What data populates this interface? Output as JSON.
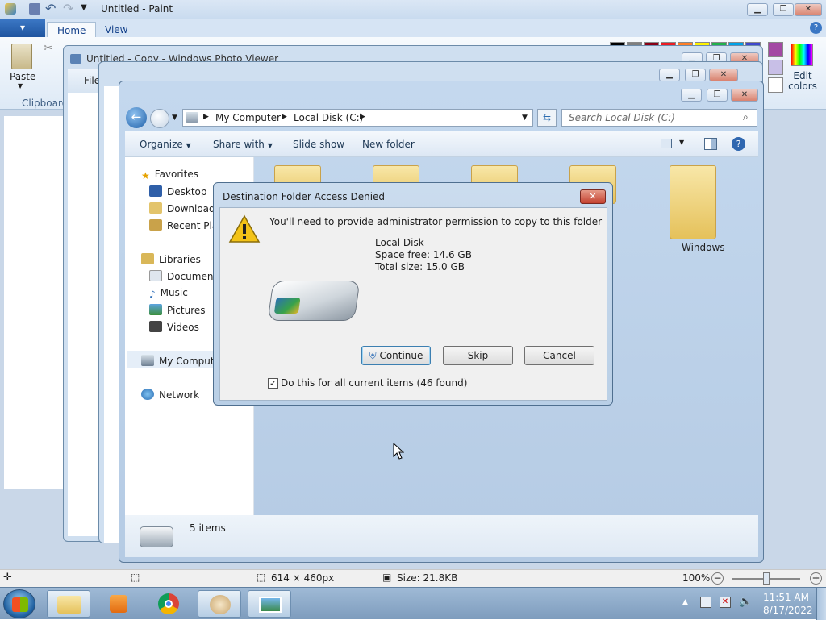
{
  "paint": {
    "title": "Untitled - Paint",
    "menu_label": "▾",
    "tabs": [
      "Home",
      "View"
    ],
    "paste_label": "Paste",
    "clipboard_label": "Clipboard",
    "edit_colors_label": "Edit colors",
    "status": {
      "dimensions": "614 × 460px",
      "size": "Size: 21.8KB",
      "zoom": "100%"
    }
  },
  "photo_viewer": {
    "title": "Untitled - Copy - Windows Photo Viewer",
    "file_label": "File"
  },
  "explorer": {
    "breadcrumb": [
      "My Computer",
      "Local Disk (C:)"
    ],
    "search_placeholder": "Search Local Disk (C:)",
    "commands": [
      "Organize",
      "Share with",
      "Slide show",
      "New folder"
    ],
    "nav": {
      "favorites": "Favorites",
      "desktop": "Desktop",
      "downloads": "Downloads",
      "recent": "Recent Places",
      "libraries": "Libraries",
      "documents": "Documents",
      "music": "Music",
      "pictures": "Pictures",
      "videos": "Videos",
      "computer": "My Computer",
      "network": "Network"
    },
    "folder_windows": "Windows",
    "items_count": "5 items"
  },
  "dialog": {
    "title": "Destination Folder Access Denied",
    "message": "You'll need to provide administrator permission to copy to this folder",
    "disk_name": "Local Disk",
    "space_free": "Space free: 14.6 GB",
    "total_size": "Total size: 15.0 GB",
    "continue": "Continue",
    "skip": "Skip",
    "cancel": "Cancel",
    "checkbox_label": "Do this for all current items (46 found)",
    "checkbox_checked": true
  },
  "taskbar": {
    "time": "11:51 AM",
    "date": "8/17/2022"
  },
  "colors": {
    "accent": "#3c7fb1",
    "close": "#c9463d"
  }
}
